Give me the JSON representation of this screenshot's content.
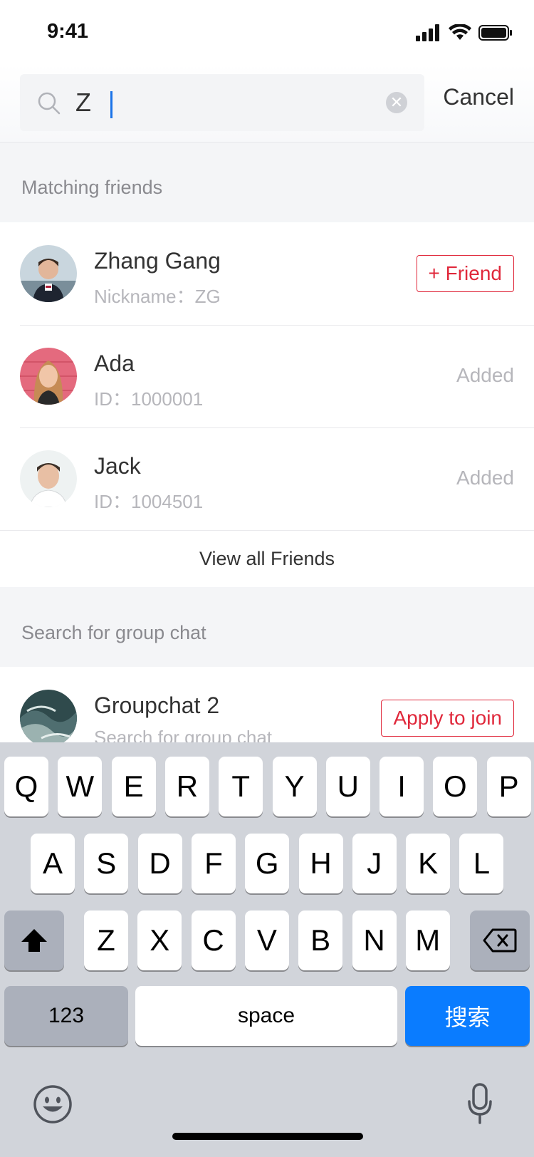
{
  "status_bar": {
    "time": "9:41"
  },
  "search": {
    "value": "Z",
    "cancel_label": "Cancel"
  },
  "friends_section": {
    "title": "Matching friends",
    "items": [
      {
        "name": "Zhang Gang",
        "sub": "Nickname：ZG",
        "action": "+ Friend",
        "action_type": "button"
      },
      {
        "name": "Ada",
        "sub": "ID：1000001",
        "action": "Added",
        "action_type": "status"
      },
      {
        "name": "Jack",
        "sub": "ID：1004501",
        "action": "Added",
        "action_type": "status"
      }
    ],
    "view_all_label": "View all Friends"
  },
  "groups_section": {
    "title": "Search for group chat",
    "items": [
      {
        "name": "Groupchat 2",
        "sub": "Search for group chat",
        "action": "Apply to join"
      }
    ]
  },
  "keyboard": {
    "row1": [
      "Q",
      "W",
      "E",
      "R",
      "T",
      "Y",
      "U",
      "I",
      "O",
      "P"
    ],
    "row2": [
      "A",
      "S",
      "D",
      "F",
      "G",
      "H",
      "J",
      "K",
      "L"
    ],
    "row3": [
      "Z",
      "X",
      "C",
      "V",
      "B",
      "N",
      "M"
    ],
    "numbers_label": "123",
    "space_label": "space",
    "search_label": "搜索",
    "icons": [
      "shift-icon",
      "backspace-icon",
      "emoji-icon",
      "microphone-icon"
    ]
  },
  "colors": {
    "accent_red": "#e0283b",
    "keyboard_blue": "#0a7cff",
    "caret_blue": "#1a73e8"
  }
}
